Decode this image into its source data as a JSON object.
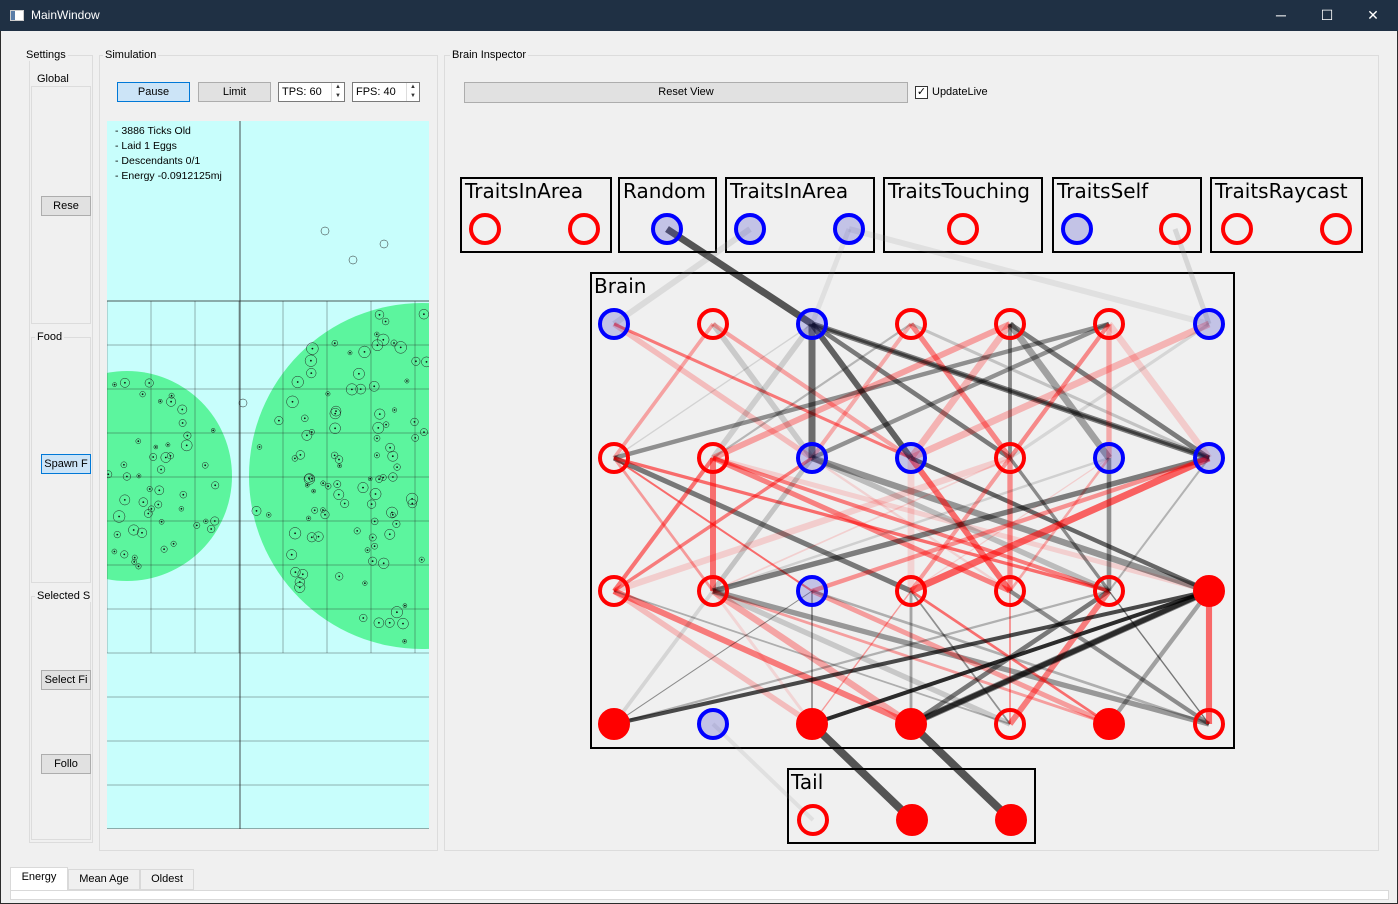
{
  "window": {
    "title": "MainWindow",
    "minimize": "─",
    "maximize": "☐",
    "close": "✕"
  },
  "settings": {
    "title": "Settings",
    "global": {
      "title": "Global",
      "reset_label": "Rese"
    },
    "food": {
      "title": "Food",
      "spawn_label": "Spawn F"
    },
    "selected": {
      "title": "Selected S",
      "select_label": "Select Fi",
      "follow_label": "Follo"
    }
  },
  "simulation": {
    "title": "Simulation",
    "pause_label": "Pause",
    "limit_label": "Limit",
    "tps": "TPS: 60",
    "fps": "FPS: 40",
    "info": [
      "- 3886 Ticks Old",
      "- Laid 1 Eggs",
      "- Descendants 0/1",
      "- Energy -0.0912125mj"
    ],
    "colors": {
      "background": "#c8fefc",
      "food": "#5cf59e",
      "grid": "#222222"
    }
  },
  "brain_inspector": {
    "title": "Brain Inspector",
    "reset_view_label": "Reset View",
    "update_live_label": "UpdateLive",
    "update_live_checked": true,
    "inputs": [
      {
        "label": "TraitsInArea",
        "nodes": [
          "red",
          "red"
        ]
      },
      {
        "label": "Random",
        "nodes": [
          "blue"
        ]
      },
      {
        "label": "TraitsInArea",
        "nodes": [
          "blue",
          "blue"
        ]
      },
      {
        "label": "TraitsTouching",
        "nodes": [
          "red"
        ]
      },
      {
        "label": "TraitsSelf",
        "nodes": [
          "blue",
          "red"
        ]
      },
      {
        "label": "TraitsRaycast",
        "nodes": [
          "red",
          "red"
        ]
      }
    ],
    "brain_label": "Brain",
    "brain_layers": [
      [
        "blue",
        "red",
        "blue",
        "red",
        "red",
        "red",
        "blue"
      ],
      [
        "red",
        "red",
        "blue",
        "blue",
        "red",
        "blue",
        "blue"
      ],
      [
        "red",
        "red",
        "blue",
        "red",
        "red",
        "red",
        "red-filled"
      ],
      [
        "red-filled",
        "blue",
        "red-filled",
        "red-filled",
        "red",
        "red-filled",
        "red"
      ]
    ],
    "tail_label": "Tail",
    "tail_nodes": [
      "red",
      "red-filled",
      "red-filled"
    ],
    "colors": {
      "positive": "#ff0000",
      "negative": "#0000ff",
      "weight_dark": "#000000"
    }
  },
  "tabs": [
    "Energy",
    "Mean Age",
    "Oldest"
  ]
}
